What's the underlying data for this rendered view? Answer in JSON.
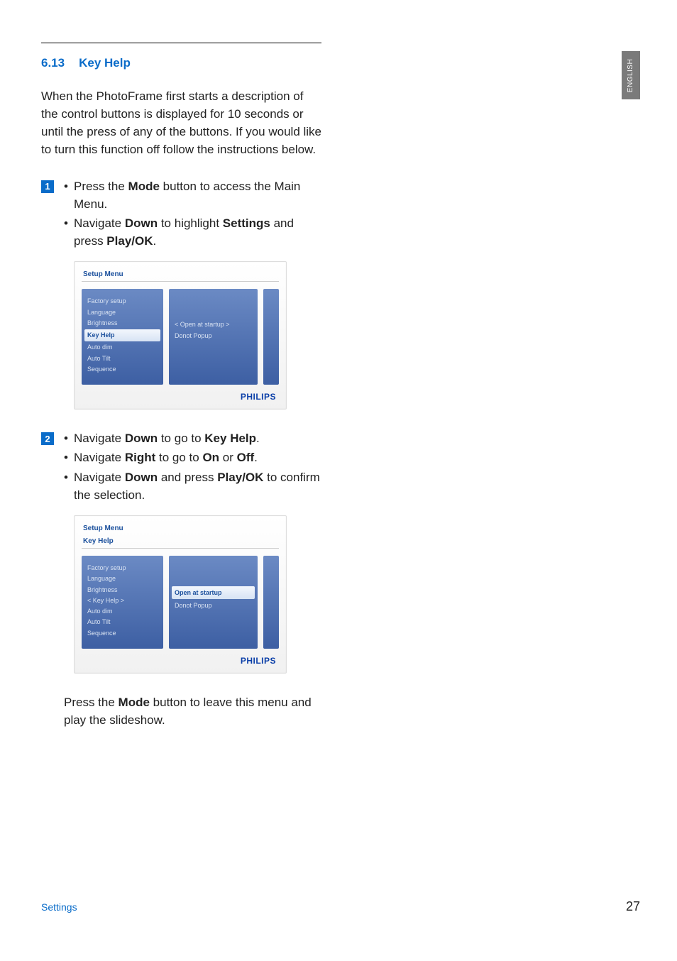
{
  "language_tab": "ENGLISH",
  "section": {
    "number": "6.13",
    "title": "Key Help"
  },
  "intro": "When the PhotoFrame first starts a description of the control buttons is displayed for 10 seconds or until the press of any of the buttons. If you would like to turn this function off follow the instructions below.",
  "steps": {
    "s1": {
      "badge": "1",
      "b1": {
        "pre": "Press the ",
        "kw": "Mode",
        "post": " button to access the Main Menu."
      },
      "b2": {
        "pre": "Navigate ",
        "kw1": "Down",
        "mid": " to highlight ",
        "kw2": "Settings",
        "mid2": " and press ",
        "kw3": "Play/OK",
        "post": "."
      }
    },
    "s2": {
      "badge": "2",
      "b1": {
        "pre": "Navigate ",
        "kw1": "Down",
        "mid": " to go to ",
        "kw2": "Key Help",
        "post": "."
      },
      "b2": {
        "pre": "Navigate ",
        "kw1": "Right",
        "mid": " to go to ",
        "kw2": "On",
        "mid2": " or ",
        "kw3": "Off",
        "post": "."
      },
      "b3": {
        "pre": "Navigate ",
        "kw1": "Down",
        "mid": " and press ",
        "kw2": "Play/OK",
        "post": " to confirm the selection."
      }
    },
    "outro": {
      "pre": "Press the ",
      "kw": "Mode",
      "post": " button to leave this menu and play the slideshow."
    }
  },
  "device_common": {
    "brand": "PHILIPS",
    "menu_items": {
      "i0": "Factory setup",
      "i1": "Language",
      "i2": "Brightness",
      "i3": "Key Help",
      "i3_alt": "< Key Help >",
      "i4": "Auto dim",
      "i5": "Auto Tilt",
      "i6": "Sequence"
    },
    "opt0": "< Open at startup >",
    "opt0_b": "Open at startup",
    "opt1": "Donot Popup"
  },
  "device1": {
    "title": "Setup Menu"
  },
  "device2": {
    "title": "Setup Menu",
    "subtitle": "Key Help"
  },
  "footer": {
    "section": "Settings",
    "page": "27"
  }
}
